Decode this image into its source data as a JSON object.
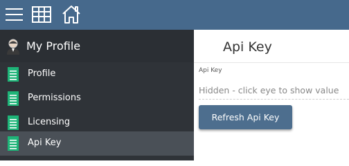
{
  "topbar": {
    "icons": [
      "menu-icon",
      "grid-icon",
      "home-icon"
    ],
    "background": "#46698c"
  },
  "sidebar": {
    "header": {
      "title": "My Profile",
      "icon": "profile-avatar-icon"
    },
    "items": [
      {
        "label": "Profile",
        "icon": "document-icon",
        "active": false
      },
      {
        "label": "Permissions",
        "icon": "document-icon",
        "active": false
      },
      {
        "label": "Licensing",
        "icon": "document-icon",
        "active": false
      },
      {
        "label": "Api Key",
        "icon": "document-icon",
        "active": true
      }
    ],
    "background": "#2f3338",
    "active_background": "#4a5057",
    "icon_color": "#1eb478"
  },
  "main": {
    "title": "Api Key",
    "field": {
      "label": "Api Key",
      "placeholder": "Hidden - click eye to show value"
    },
    "refresh_button": "Refresh Api Key",
    "button_color": "#4d6e8e"
  }
}
